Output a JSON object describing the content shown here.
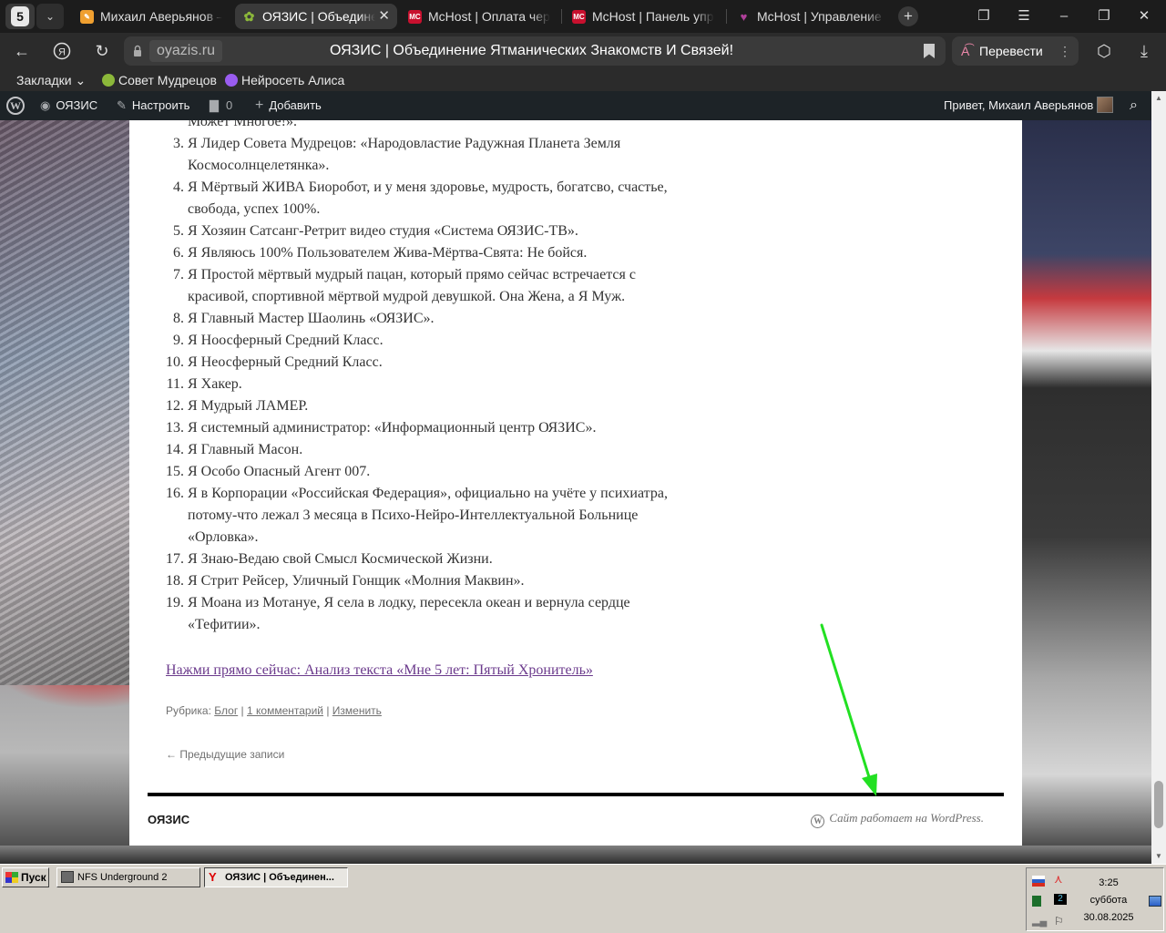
{
  "browser": {
    "profile_number": "5",
    "tabs": [
      {
        "title": "Михаил Аверьянов — ",
        "favicon_color": "#f0a030",
        "active": false
      },
      {
        "title": "ОЯЗИС | Объединение Ятманических Знакомств И Связей!",
        "favicon_color": "#8cb83a",
        "active": true
      },
      {
        "title": "McHost | Оплата через",
        "favicon_color": "#c8102e",
        "favicon_text": "MC",
        "active": false
      },
      {
        "title": "McHost | Панель управления",
        "favicon_color": "#c8102e",
        "favicon_text": "MC",
        "active": false
      },
      {
        "title": "McHost | Управление хостингом",
        "favicon_color": "#b0409a",
        "active": false
      }
    ],
    "domain": "oyazis.ru",
    "page_title": "ОЯЗИС | Объединение Ятманических Знакомств И Связей!",
    "translate_label": "Перевести",
    "bookmarks": [
      {
        "label": "Закладки ⌄"
      },
      {
        "label": "Совет Мудрецов",
        "icon_color": "#8cb83a"
      },
      {
        "label": "Нейросеть Алиса",
        "icon_color": "#9a5cf0"
      }
    ]
  },
  "wp_admin_bar": {
    "site_name": "ОЯЗИС",
    "customize": "Настроить",
    "comments_count": "0",
    "add_new": "Добавить",
    "greeting": "Привет, Михаил Аверьянов"
  },
  "article": {
    "list_lines": [
      {
        "num": "",
        "text": "Может Многое!».",
        "partial": true
      },
      {
        "num": "3.",
        "text": "Я Лидер Совета Мудрецов: «Народовластие Радужная Планета Земля"
      },
      {
        "num": "",
        "text": "Космосолнцелетянка»."
      },
      {
        "num": "4.",
        "text": "Я Мёртвый ЖИВА Биоробот, и у меня здоровье, мудрость, богатсво, счастье,"
      },
      {
        "num": "",
        "text": "свобода, успех 100%."
      },
      {
        "num": "5.",
        "text": "Я Хозяин Сатсанг-Ретрит видео студия «Система ОЯЗИС-ТВ»."
      },
      {
        "num": "6.",
        "text": "Я Являюсь 100% Пользователем Жива-Мёртва-Свята: Не бойся."
      },
      {
        "num": "7.",
        "text": "Я Простой мёртвый мудрый пацан, который прямо сейчас встречается с"
      },
      {
        "num": "",
        "text": "красивой, спортивной мёртвой мудрой девушкой. Она Жена, а Я Муж."
      },
      {
        "num": "8.",
        "text": "Я Главный Мастер Шаолинь «ОЯЗИС»."
      },
      {
        "num": "9.",
        "text": "Я Ноосферный Средний Класс."
      },
      {
        "num": "10.",
        "text": "Я Неосферный Средний Класс."
      },
      {
        "num": "11.",
        "text": "Я Хакер."
      },
      {
        "num": "12.",
        "text": "Я Мудрый ЛАМЕР."
      },
      {
        "num": "13.",
        "text": "Я системный администратор: «Информационный центр ОЯЗИС»."
      },
      {
        "num": "14.",
        "text": "Я Главный Масон."
      },
      {
        "num": "15.",
        "text": "Я Особо Опасный Агент 007."
      },
      {
        "num": "16.",
        "text": "Я в Корпорации «Российская Федерация», официально на учёте у психиатра,"
      },
      {
        "num": "",
        "text": "потому-что лежал 3 месяца в Психо-Нейро-Интеллектуальной Больнице"
      },
      {
        "num": "",
        "text": "«Орловка»."
      },
      {
        "num": "17.",
        "text": "Я Знаю-Ведаю свой Смысл Космической Жизни."
      },
      {
        "num": "18.",
        "text": "Я Стрит Рейсер, Уличный Гонщик «Молния Маквин»."
      },
      {
        "num": "19.",
        "text": "Я Моана из Мотануе, Я села в лодку, пересекла океан и вернула сердце"
      },
      {
        "num": "",
        "text": "«Тефитии»."
      }
    ],
    "continue_link": "Нажми прямо сейчас: Анализ текста «Мне 5 лет: Пятый Хронитель»",
    "meta": {
      "category_label": "Рубрика:",
      "category": "Блог",
      "comments": "1 комментарий",
      "edit": "Изменить"
    },
    "prev_posts": "← Предыдущие записи"
  },
  "footer": {
    "site_name": "ОЯЗИС",
    "powered_by": "Сайт работает на WordPress."
  },
  "scrollbar": {
    "position_fraction": 0.97
  },
  "taskbar": {
    "start_label": "Пуск",
    "tasks": [
      {
        "label": "NFS Underground 2",
        "active": false
      },
      {
        "label": "ОЯЗИС | Объединен...",
        "active": true
      }
    ],
    "clock": {
      "time": "3:25",
      "day": "суббота",
      "date": "30.08.2025"
    }
  },
  "colors": {
    "accent_arrow": "#22e022",
    "link_visited": "#6b3a8c",
    "wp_bar": "#1d2327"
  }
}
